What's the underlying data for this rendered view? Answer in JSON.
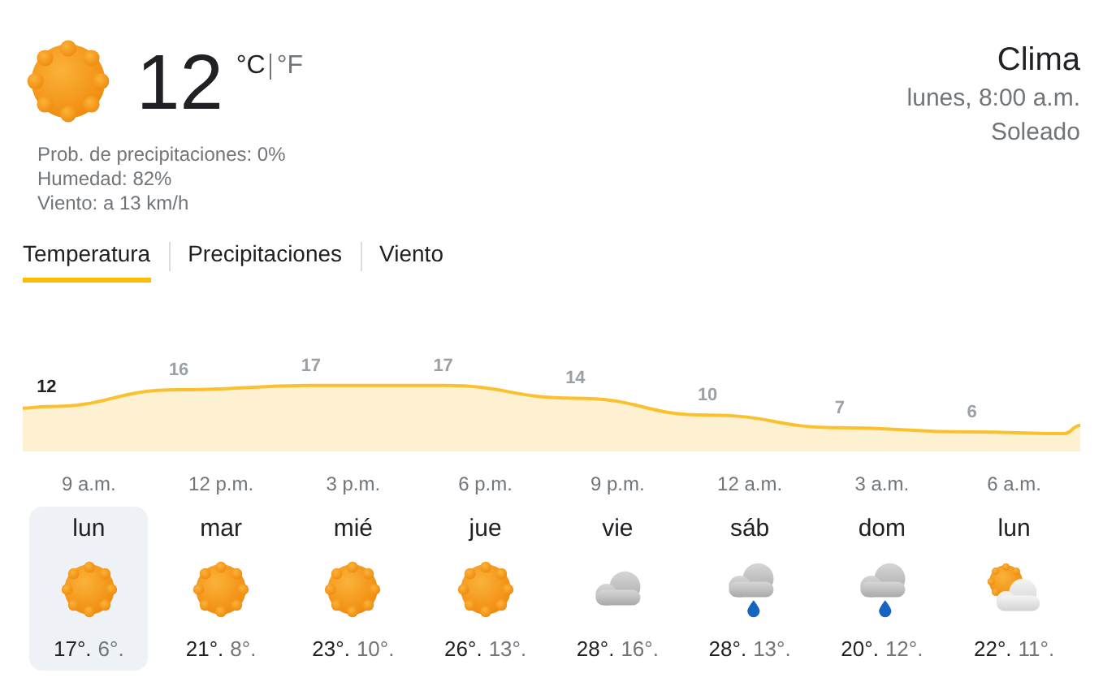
{
  "current": {
    "kind": "sunny",
    "temperature": "12",
    "units": [
      {
        "label": "°C",
        "selected": true
      },
      {
        "label": "°F",
        "selected": false
      }
    ],
    "details": [
      "Prob. de precipitaciones: 0%",
      "Humedad: 82%",
      "Viento: a 13 km/h"
    ]
  },
  "header": {
    "title": "Clima",
    "datetime": "lunes, 8:00 a.m.",
    "condition": "Soleado"
  },
  "tabs": [
    {
      "label": "Temperatura",
      "selected": true
    },
    {
      "label": "Precipitaciones",
      "selected": false
    },
    {
      "label": "Viento",
      "selected": false
    }
  ],
  "hourly": [
    {
      "time": "9 a.m.",
      "temperature": "12",
      "selected": true
    },
    {
      "time": "12 p.m.",
      "temperature": "16",
      "selected": false
    },
    {
      "time": "3 p.m.",
      "temperature": "17",
      "selected": false
    },
    {
      "time": "6 p.m.",
      "temperature": "17",
      "selected": false
    },
    {
      "time": "9 p.m.",
      "temperature": "14",
      "selected": false
    },
    {
      "time": "12 a.m.",
      "temperature": "10",
      "selected": false
    },
    {
      "time": "3 a.m.",
      "temperature": "7",
      "selected": false
    },
    {
      "time": "6 a.m.",
      "temperature": "6",
      "selected": false
    }
  ],
  "days": [
    {
      "name": "lun",
      "kind": "sunny",
      "high": "17°.",
      "low": "6°.",
      "selected": true
    },
    {
      "name": "mar",
      "kind": "sunny",
      "high": "21°.",
      "low": "8°.",
      "selected": false
    },
    {
      "name": "mié",
      "kind": "sunny",
      "high": "23°.",
      "low": "10°.",
      "selected": false
    },
    {
      "name": "jue",
      "kind": "sunny",
      "high": "26°.",
      "low": "13°.",
      "selected": false
    },
    {
      "name": "vie",
      "kind": "cloudy",
      "high": "28°.",
      "low": "16°.",
      "selected": false
    },
    {
      "name": "sáb",
      "kind": "rain",
      "high": "28°.",
      "low": "13°.",
      "selected": false
    },
    {
      "name": "dom",
      "kind": "rain",
      "high": "20°.",
      "low": "12°.",
      "selected": false
    },
    {
      "name": "lun",
      "kind": "partly",
      "high": "22°.",
      "low": "11°.",
      "selected": false
    }
  ]
}
